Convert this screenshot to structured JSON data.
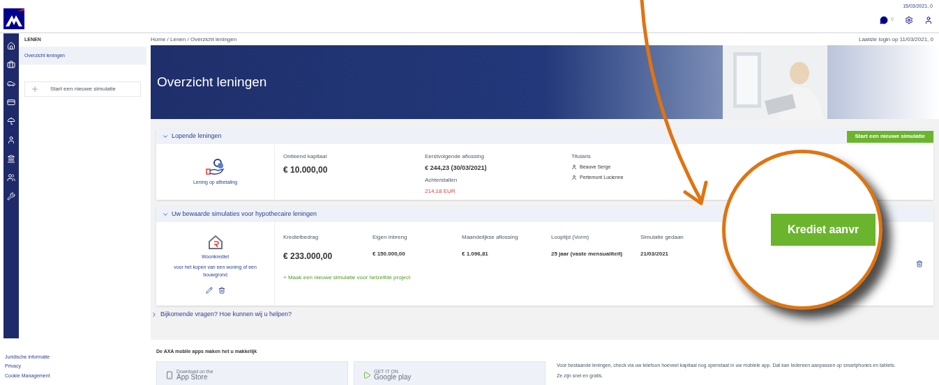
{
  "header": {
    "date": "15/03/2021, 0",
    "badge_count": "0"
  },
  "sidebar": {
    "title": "LENEN",
    "items": [
      {
        "label": "Overzicht leningen",
        "selected": true
      }
    ],
    "button": "Start een nieuwe simulatie"
  },
  "breadcrumb": "Home / Lenen / Overzicht leningen",
  "last_login": "Laatste login op 11/03/2021, 0",
  "banner": {
    "title": "Overzicht leningen"
  },
  "current_loans": {
    "title": "Lopende leningen",
    "expanded": true,
    "button": "Start een nieuwe simulatie",
    "loan": {
      "type": "Lening op afbetaling",
      "fields": [
        {
          "label": "Ontleend kapitaal",
          "value": "€ 10.000,00",
          "kind": "main"
        }
      ],
      "next": {
        "label": "Eerstvolgende aflossing",
        "value": "€ 244,23 (30/03/2021)"
      },
      "arrears": {
        "label": "Achterstallen",
        "value": "214,18 EUR"
      },
      "holders": {
        "label": "Titularis",
        "names": [
          "Beauve Serge",
          "Pertemont Lucienne"
        ]
      }
    }
  },
  "simulations": {
    "title": "Uw bewaarde simulaties voor hypothecaire leningen",
    "expanded": true,
    "item": {
      "type": "Woonkrediet",
      "description": "voor het kopen van een woning of een bouwgrond",
      "columns": [
        {
          "label": "Kredietbedrag",
          "value": "€ 233.000,00",
          "kind": "main"
        },
        {
          "label": "Eigen inbreng",
          "value": "€ 150.000,00",
          "kind": "detail"
        },
        {
          "label": "Maandelijkse aflossing",
          "value": "€ 1.096,81",
          "kind": "detail"
        },
        {
          "label": "Looptijd (Vorm)",
          "value": "25 jaar (vaste mensualiteit)",
          "kind": "detail"
        },
        {
          "label": "Simulatie gedaan",
          "value": "21/03/2021",
          "kind": "detail"
        }
      ],
      "link": "+ Maak een nieuwe simulatie voor hetzelfde project"
    }
  },
  "help": {
    "title": "Bijkomende vragen? Hoe kunnen wij u helpen?",
    "expanded": false
  },
  "footer": {
    "links": [
      "Juridische informatie",
      "Privacy",
      "Cookie Management"
    ],
    "apps_title": "De AXA mobile apps maken het u makkelijk",
    "stores": [
      {
        "small": "Download on the",
        "name": "App Store"
      },
      {
        "small": "GET IT ON",
        "name": "Google play"
      }
    ],
    "text": [
      "Voor bestaande leningen, check via uw telefoon hoeveel kapitaal nog openstaat in uw mobiele app. Dat kan Iedereen aanpassen op smartphones en tablets.",
      "Ze zijn snel en gratis."
    ]
  },
  "callout": {
    "button": "Krediet aanvr"
  }
}
